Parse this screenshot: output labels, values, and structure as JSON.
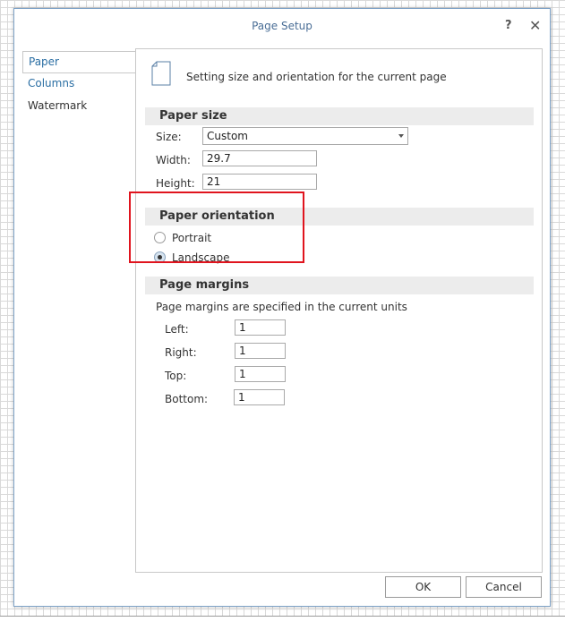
{
  "dialog": {
    "title": "Page Setup",
    "help_label": "?",
    "close_label": "✕"
  },
  "nav": {
    "items": [
      {
        "label": "Paper",
        "selected": true
      },
      {
        "label": "Columns",
        "selected": false
      },
      {
        "label": "Watermark",
        "selected": false
      }
    ]
  },
  "header": {
    "icon": "page-icon",
    "text": "Setting size and orientation for the current page"
  },
  "paper_size": {
    "section_title": "Paper size",
    "size_label": "Size:",
    "size_value": "Custom",
    "width_label": "Width:",
    "width_value": "29.7",
    "height_label": "Height:",
    "height_value": "21"
  },
  "orientation": {
    "section_title": "Paper orientation",
    "portrait_label": "Portrait",
    "landscape_label": "Landscape",
    "selected": "Landscape",
    "highlight_color": "#e0141e"
  },
  "margins": {
    "section_title": "Page margins",
    "description": "Page margins are specified in the current units",
    "left_label": "Left:",
    "left_value": "1",
    "right_label": "Right:",
    "right_value": "1",
    "top_label": "Top:",
    "top_value": "1",
    "bottom_label": "Bottom:",
    "bottom_value": "1"
  },
  "buttons": {
    "ok_label": "OK",
    "cancel_label": "Cancel"
  },
  "colors": {
    "title_text": "#4a6e96",
    "nav_link": "#2a6ea3",
    "section_bg": "#ececec"
  }
}
